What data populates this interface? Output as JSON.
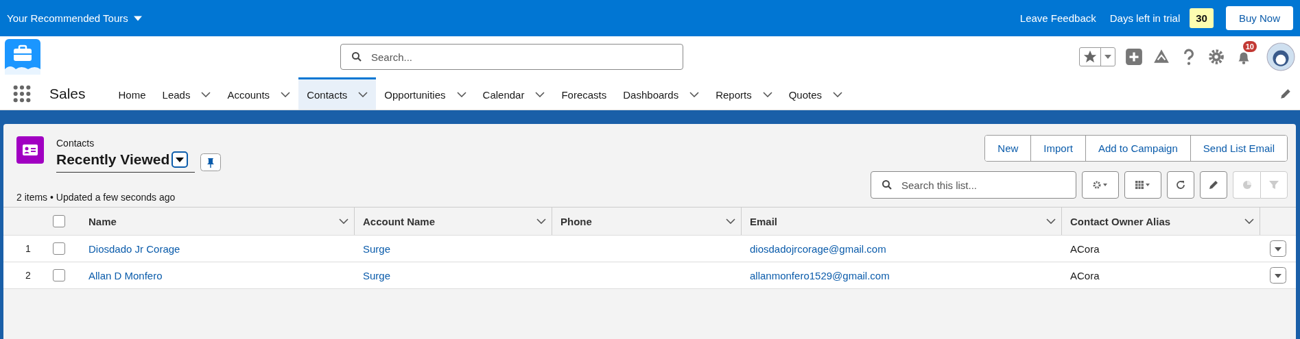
{
  "top_bar": {
    "tours": "Your Recommended Tours",
    "feedback": "Leave Feedback",
    "trial_label": "Days left in trial",
    "trial_days": "30",
    "buy": "Buy Now"
  },
  "header": {
    "search_placeholder": "Search...",
    "notification_count": "10"
  },
  "app_name": "Sales",
  "nav": [
    {
      "label": "Home",
      "menu": false,
      "selected": false
    },
    {
      "label": "Leads",
      "menu": true,
      "selected": false
    },
    {
      "label": "Accounts",
      "menu": true,
      "selected": false
    },
    {
      "label": "Contacts",
      "menu": true,
      "selected": true
    },
    {
      "label": "Opportunities",
      "menu": true,
      "selected": false
    },
    {
      "label": "Calendar",
      "menu": true,
      "selected": false
    },
    {
      "label": "Forecasts",
      "menu": false,
      "selected": false
    },
    {
      "label": "Dashboards",
      "menu": true,
      "selected": false
    },
    {
      "label": "Reports",
      "menu": true,
      "selected": false
    },
    {
      "label": "Quotes",
      "menu": true,
      "selected": false
    }
  ],
  "list": {
    "object": "Contacts",
    "view": "Recently Viewed",
    "status": "2 items • Updated a few seconds ago",
    "actions": [
      "New",
      "Import",
      "Add to Campaign",
      "Send List Email"
    ],
    "search_placeholder": "Search this list..."
  },
  "table": {
    "select_all_checked": false,
    "columns": [
      "Name",
      "Account Name",
      "Phone",
      "Email",
      "Contact Owner Alias"
    ],
    "rows": [
      {
        "index": "1",
        "checked": false,
        "name": "Diosdado Jr Corage",
        "account": "Surge",
        "phone": "",
        "email": "diosdadojrcorage@gmail.com",
        "owner": "ACora"
      },
      {
        "index": "2",
        "checked": false,
        "name": "Allan D Monfero",
        "account": "Surge",
        "phone": "",
        "email": "allanmonfero1529@gmail.com",
        "owner": "ACora"
      }
    ]
  }
}
